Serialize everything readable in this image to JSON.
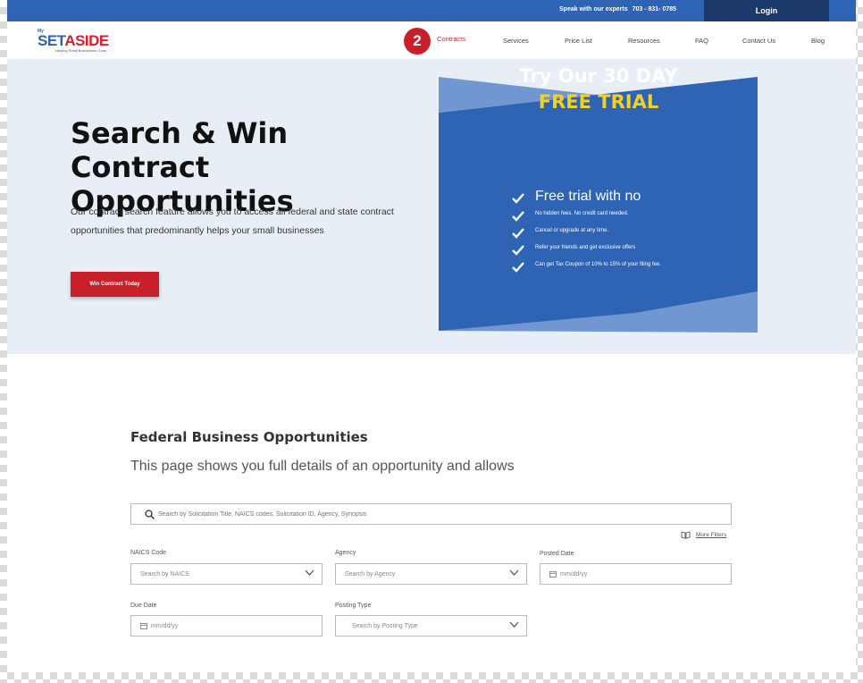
{
  "topbar": {
    "speak_label": "Speak with our experts",
    "phone": "703 - 831- 0785",
    "login_label": "Login"
  },
  "brand": {
    "my": "My",
    "set": "SET",
    "aside": "ASIDE",
    "tagline": "Helping Small Businesses Grow"
  },
  "nav": {
    "step_badge": "2",
    "items": [
      "Contracts",
      "Services",
      "Price List",
      "Resources",
      "FAQ",
      "Contact Us",
      "Blog"
    ]
  },
  "hero": {
    "title": "Search & Win Contract Opportunities",
    "description": "Our contract search feature allows you to access all federal and state contract opportunities that predominantly helps your small businesses",
    "cta_label": "Win Contract Today"
  },
  "trial": {
    "title": "Try Our 30 DAY",
    "subtitle": "FREE TRIAL",
    "features": [
      "Free trial with no",
      "No hidden fees. No credit card needed.",
      "Cancel or upgrade at any time.",
      "Refer your friends and get exclusive offers",
      "Can get Tax Coupon of 10% to 15% of your filing fee."
    ]
  },
  "federal": {
    "title": "Federal Business Opportunities",
    "description": "This page shows you full details of an opportunity and allows",
    "search_placeholder": "Search by Solicitation Title, NAICS codes, Solicitation ID, Agency, Synopsis",
    "more_filters": "More Filters",
    "filters": {
      "naics": {
        "label": "NAICS Code",
        "placeholder": "Search by NAICS"
      },
      "agency": {
        "label": "Agency",
        "placeholder": "Search by Agency"
      },
      "posted": {
        "label": "Posted Date",
        "placeholder": "mm/dd/yy"
      },
      "due": {
        "label": "Due Date",
        "placeholder": "mm/dd/yy"
      },
      "posting_type": {
        "label": "Posting Type",
        "placeholder": "Search by Posting Type"
      }
    }
  },
  "colors": {
    "primary_blue": "#2f63b4",
    "dark_navy": "#1b3a6b",
    "accent_red": "#c8202b",
    "highlight_yellow": "#f2d024",
    "hero_bg": "#e8eef6"
  },
  "icons": {
    "search": "search-icon",
    "book": "book-icon",
    "calendar": "calendar-icon",
    "chevron": "chevron-down-icon",
    "check": "check-icon"
  }
}
